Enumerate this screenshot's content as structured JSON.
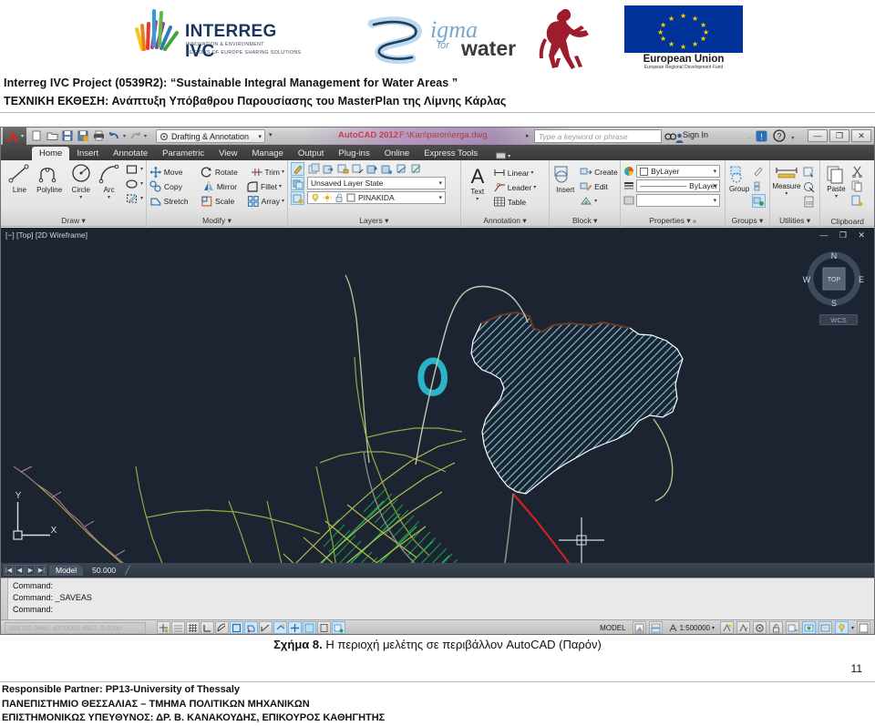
{
  "document": {
    "project_line": "Interreg IVC Project (0539R2): “Sustainable Integral Management for Water Areas ”",
    "report_line": "ΤΕΧΝΙΚΗ  ΕΚΘΕΣΗ: Ανάπτυξη Υπόβαθρου Παρουσίασης του MasterPlan της Λίμνης Κάρλας",
    "caption_bold": "Σχήμα 8.",
    "caption_rest": " Η περιοχή μελέτης σε περιβάλλον AutoCAD (Παρόν)",
    "page_number": "11",
    "footer": [
      "Responsible Partner: PP13-University of Thessaly",
      "ΠΑΝΕΠΙΣΤΗΜΙΟ ΘΕΣΣΑΛΙΑΣ – ΤΜΗΜΑ ΠΟΛΙΤΙΚΩΝ ΜΗΧΑΝΙΚΩΝ",
      "ΕΠΙΣΤΗΜΟΝΙΚΩΣ ΥΠΕΥΘΥΝΟΣ: ΔΡ. Β. ΚΑΝΑΚΟΥΔΗΣ, ΕΠΙΚΟΥΡΟΣ ΚΑΘΗΓΗΤΗΣ"
    ]
  },
  "logos": {
    "interreg_title": "INTERREG IVC",
    "interreg_sub1": "INNOVATION & ENVIRONMENT",
    "interreg_sub2": "REGIONS OF EUROPE SHARING SOLUTIONS",
    "sigma_word": "igma",
    "sigma_for": "for",
    "sigma_water": "water",
    "eu_caption": "European Union",
    "eu_subcaption": "European Regional Development Fund"
  },
  "autocad": {
    "app_name": "AutoCAD 2012",
    "file_path": "F:\\Kan\\paron\\erga.dwg",
    "workspace": "Drafting & Annotation",
    "search_placeholder": "Type a keyword or phrase",
    "sign_in": "Sign In",
    "quick_access": [
      "new-icon",
      "open-icon",
      "save-icon",
      "saveas-icon",
      "plot-icon",
      "undo-icon",
      "redo-icon"
    ],
    "window_buttons": [
      "minimize",
      "restore",
      "close"
    ],
    "ribbon_tabs": [
      {
        "label": "Home",
        "active": true
      },
      {
        "label": "Insert",
        "active": false
      },
      {
        "label": "Annotate",
        "active": false
      },
      {
        "label": "Parametric",
        "active": false
      },
      {
        "label": "View",
        "active": false
      },
      {
        "label": "Manage",
        "active": false
      },
      {
        "label": "Output",
        "active": false
      },
      {
        "label": "Plug-ins",
        "active": false
      },
      {
        "label": "Online",
        "active": false
      },
      {
        "label": "Express Tools",
        "active": false
      }
    ],
    "panels": {
      "draw": {
        "title": "Draw",
        "tools": [
          "Line",
          "Polyline",
          "Circle",
          "Arc"
        ]
      },
      "modify": {
        "title": "Modify",
        "tools": [
          "Move",
          "Rotate",
          "Trim",
          "Copy",
          "Mirror",
          "Fillet",
          "Stretch",
          "Scale",
          "Array"
        ]
      },
      "layers": {
        "title": "Layers",
        "layer_state": "Unsaved Layer State",
        "current_layer": "PINAKIDA"
      },
      "annotation": {
        "title": "Annotation",
        "text_label": "Text",
        "items": [
          "Linear",
          "Leader",
          "Table"
        ]
      },
      "block": {
        "title": "Block",
        "insert_label": "Insert",
        "items": [
          "Create",
          "Edit"
        ]
      },
      "properties": {
        "title": "Properties",
        "color": "ByLayer",
        "linetype": "ByLayer",
        "lineweight": ""
      },
      "groups": {
        "title": "Groups",
        "label": "Group"
      },
      "utilities": {
        "title": "Utilities",
        "label": "Measure"
      },
      "clipboard": {
        "title": "Clipboard",
        "label": "Paste"
      }
    },
    "viewport": {
      "label": "[−] [Top] [2D Wireframe]",
      "viewcube": {
        "north": "N",
        "south": "S",
        "east": "E",
        "west": "W",
        "face": "TOP",
        "ucs": "WCS"
      },
      "ucs_axes": {
        "x": "X",
        "y": "Y"
      }
    },
    "layout_tabs": [
      {
        "label": "Model",
        "active": true
      },
      {
        "label": "50.000",
        "active": false
      }
    ],
    "command_lines": [
      "Command:",
      "Command: _SAVEAS",
      "Command:"
    ],
    "status_bar": {
      "coordinates": "395702.9490, 4370060.4667, 0.0000",
      "space": "MODEL",
      "annotation_scale": "1:500000",
      "toggles": [
        {
          "name": "infer-constraints",
          "on": false
        },
        {
          "name": "snap-mode",
          "on": false
        },
        {
          "name": "grid-display",
          "on": false
        },
        {
          "name": "ortho-mode",
          "on": false
        },
        {
          "name": "polar-tracking",
          "on": false
        },
        {
          "name": "object-snap",
          "on": true
        },
        {
          "name": "3d-object-snap",
          "on": true
        },
        {
          "name": "object-snap-tracking",
          "on": false
        },
        {
          "name": "dynamic-ucs",
          "on": true
        },
        {
          "name": "dynamic-input",
          "on": true
        },
        {
          "name": "lineweight",
          "on": true
        },
        {
          "name": "transparency",
          "on": false
        },
        {
          "name": "quick-properties",
          "on": true
        }
      ]
    },
    "drawing": {
      "description": "Lake Karla study area map",
      "colors": {
        "background": "#1b2430",
        "lake_hatch": "#79c4d6",
        "lake_outline": "#ffffff",
        "parcel_green": "#22a84a",
        "road_olive": "#a8ad4a",
        "road_red": "#cc2222",
        "river_purple": "#9b6d8c",
        "pond_cyan": "#2bb3c8"
      }
    }
  }
}
